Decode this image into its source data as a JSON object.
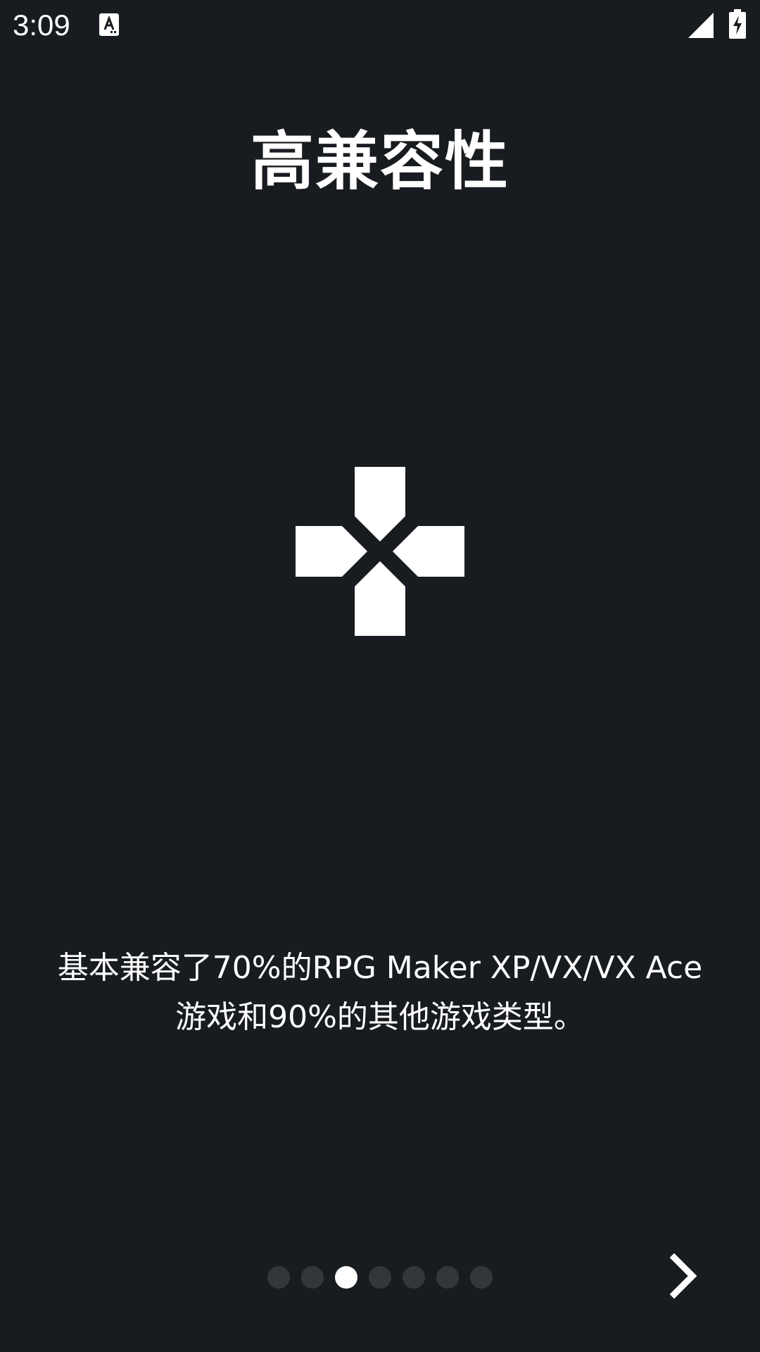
{
  "status_bar": {
    "time": "3:09",
    "notification_icon": "text-input-a-icon",
    "signal_icon": "cell-signal-icon",
    "battery_icon": "battery-charging-icon"
  },
  "onboarding": {
    "title": "高兼容性",
    "illustration_icon": "dpad-icon",
    "description_line1": "基本兼容了70%的RPG Maker XP/VX/VX Ace",
    "description_line2": "游戏和90%的其他游戏类型。",
    "page_count": 7,
    "current_page": 3,
    "next_icon": "chevron-right-icon"
  },
  "colors": {
    "background": "#181c20",
    "foreground": "#ffffff",
    "dot_inactive": "#33373c"
  }
}
